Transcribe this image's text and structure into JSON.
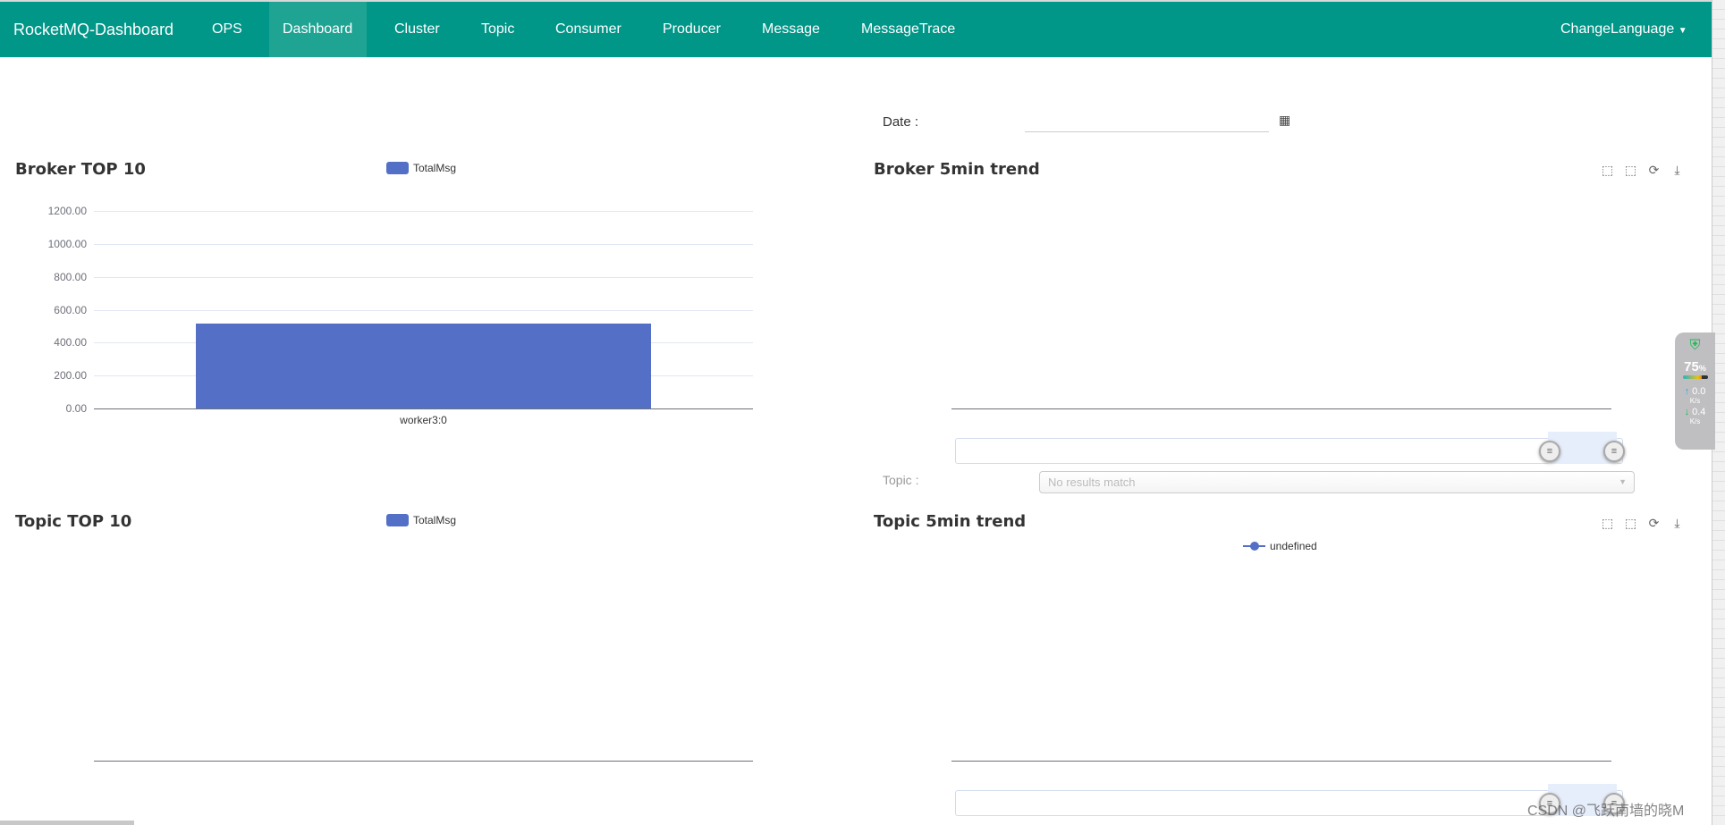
{
  "nav": {
    "brand": "RocketMQ-Dashboard",
    "items": [
      "OPS",
      "Dashboard",
      "Cluster",
      "Topic",
      "Consumer",
      "Producer",
      "Message",
      "MessageTrace"
    ],
    "active": "Dashboard",
    "language": "ChangeLanguage"
  },
  "date": {
    "label": "Date :",
    "value": "",
    "icon": "calendar-icon"
  },
  "topic_filter": {
    "label": "Topic :",
    "placeholder": "No results match"
  },
  "panels": {
    "broker_top": {
      "title": "Broker TOP 10",
      "legend": "TotalMsg"
    },
    "broker_trend": {
      "title": "Broker 5min trend"
    },
    "topic_top": {
      "title": "Topic TOP 10",
      "legend": "TotalMsg"
    },
    "topic_trend": {
      "title": "Topic 5min trend",
      "legend": "undefined"
    }
  },
  "toolbox": [
    "zoom-icon",
    "zoom-reset-icon",
    "restore-icon",
    "save-image-icon"
  ],
  "colors": {
    "nav": "#009688",
    "nav_active": "#1fa393",
    "series": "#5470c6"
  },
  "chart_data": [
    {
      "type": "bar",
      "title": "Broker TOP 10",
      "categories": [
        "worker3:0"
      ],
      "series": [
        {
          "name": "TotalMsg",
          "values": [
            515
          ]
        }
      ],
      "yticks": [
        "0.00",
        "200.00",
        "400.00",
        "600.00",
        "800.00",
        "1000.00",
        "1200.00"
      ],
      "ylim": [
        0,
        1200
      ],
      "grid": true,
      "legend": "top-center"
    },
    {
      "type": "line",
      "title": "Broker 5min trend",
      "series": [],
      "datazoom": true
    },
    {
      "type": "bar",
      "title": "Topic TOP 10",
      "categories": [],
      "series": [
        {
          "name": "TotalMsg",
          "values": []
        }
      ],
      "legend": "top-center"
    },
    {
      "type": "line",
      "title": "Topic 5min trend",
      "series": [
        {
          "name": "undefined",
          "values": []
        }
      ],
      "legend": "top-center",
      "datazoom": true
    }
  ],
  "widget": {
    "percent": "75",
    "percent_unit": "%",
    "up": "0.0",
    "down": "0.4",
    "unit": "K/s"
  },
  "watermark": "CSDN @飞跃南墙的晓M"
}
